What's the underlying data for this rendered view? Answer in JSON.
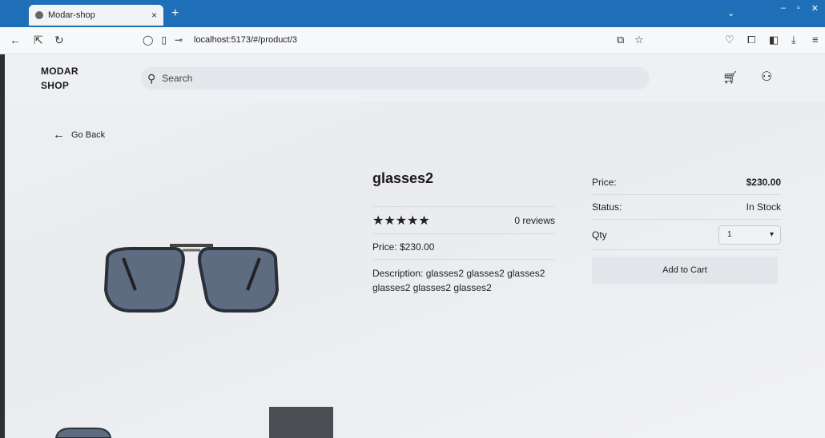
{
  "browser": {
    "tab_title": "Modar-shop",
    "tab_close": "×",
    "new_tab": "+",
    "url": "localhost:5173/#/product/3"
  },
  "header": {
    "logo_line1": "MODAR",
    "logo_line2": "SHOP",
    "search_placeholder": "Search"
  },
  "nav": {
    "go_back": "Go Back"
  },
  "product": {
    "title": "glasses2",
    "rating_stars": 5,
    "stars_display": "★★★★★",
    "reviews": "0 reviews",
    "price_text": "Price: $230.00",
    "description": "Description: glasses2 glasses2 glasses2 glasses2 glasses2 glasses2"
  },
  "purchase": {
    "price_label": "Price:",
    "price_value": "$230.00",
    "status_label": "Status:",
    "status_value": "In Stock",
    "qty_label": "Qty",
    "qty_value": "1",
    "add_to_cart": "Add to Cart"
  },
  "colors": {
    "browser_accent": "#1f6fb8",
    "page_bg": "#eef0f3"
  },
  "icons": [
    "back-arrow-icon",
    "reload-icon",
    "shield-icon",
    "page-icon",
    "key-icon",
    "translate-icon",
    "star-bookmark-icon",
    "pocket-icon",
    "extensions-icon",
    "download-icon",
    "menu-icon",
    "search-icon",
    "cart-icon",
    "user-icon",
    "chevron-down-icon"
  ]
}
